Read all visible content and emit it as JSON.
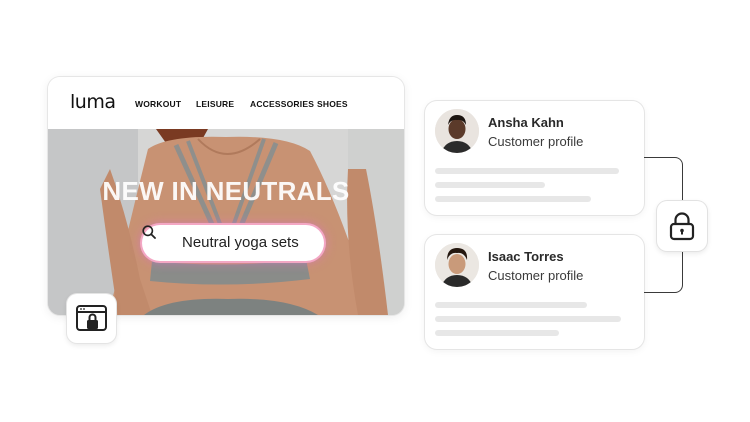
{
  "site": {
    "logo": "luma",
    "nav": [
      "WORKOUT",
      "LEISURE",
      "ACCESSORIES",
      "SHOES"
    ],
    "hero_title": "NEW IN NEUTRALS",
    "search_text": "Neutral yoga sets"
  },
  "profiles": [
    {
      "name": "Ansha Kahn",
      "subtitle": "Customer profile"
    },
    {
      "name": "Isaac Torres",
      "subtitle": "Customer profile"
    }
  ],
  "icons": {
    "search": "search-icon",
    "browser_lock": "browser-lock-icon",
    "padlock": "lock-icon"
  },
  "colors": {
    "search_glow": "#f3a7c4",
    "skeleton": "#e7e7e7",
    "connector": "#3a3a3a"
  }
}
